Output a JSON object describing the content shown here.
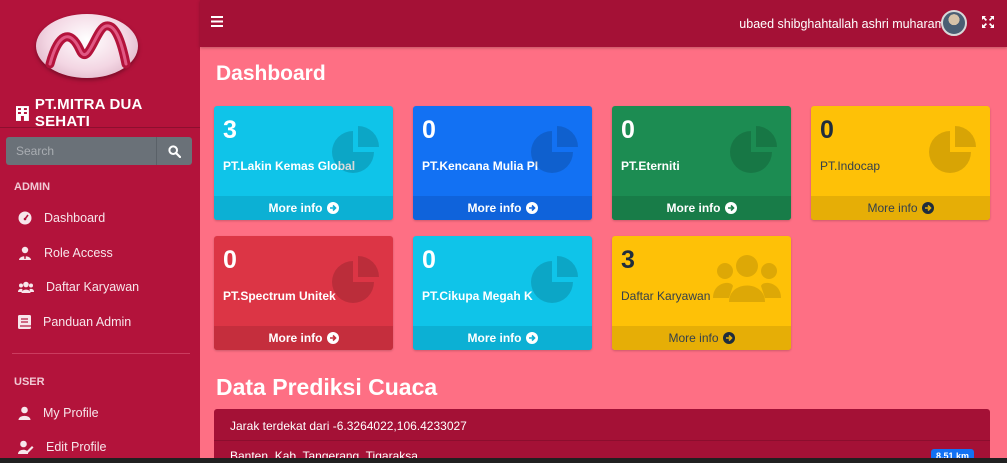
{
  "brand": {
    "name": "PT.MITRA DUA SEHATI"
  },
  "search": {
    "placeholder": "Search"
  },
  "sidebar": {
    "admin_header": "ADMIN",
    "user_header": "USER",
    "admin_items": [
      {
        "label": "Dashboard",
        "icon": "dashboard-icon"
      },
      {
        "label": "Role Access",
        "icon": "user-tie-icon"
      },
      {
        "label": "Daftar Karyawan",
        "icon": "users-icon"
      },
      {
        "label": "Panduan Admin",
        "icon": "book-icon"
      }
    ],
    "user_items": [
      {
        "label": "My Profile",
        "icon": "user-icon"
      },
      {
        "label": "Edit Profile",
        "icon": "user-edit-icon"
      }
    ]
  },
  "header": {
    "username": "ubaed shibghahtallah ashri muharam"
  },
  "main": {
    "title": "Dashboard",
    "boxes": [
      {
        "count": "3",
        "label": "PT.Lakin Kemas Global",
        "footer": "More info",
        "color": "#0fc4e9"
      },
      {
        "count": "0",
        "label": "PT.Kencana Mulia PI",
        "footer": "More info",
        "color": "#1271f3"
      },
      {
        "count": "0",
        "label": "PT.Eterniti",
        "footer": "More info",
        "color": "#1c8c52"
      },
      {
        "count": "0",
        "label": "PT.Indocap",
        "footer": "More info",
        "color": "#fec107"
      },
      {
        "count": "0",
        "label": "PT.Spectrum Unitek",
        "footer": "More info",
        "color": "#dc3545"
      },
      {
        "count": "0",
        "label": "PT.Cikupa Megah K",
        "footer": "More info",
        "color": "#0fc4e9"
      },
      {
        "count": "3",
        "label": "Daftar Karyawan",
        "footer": "More info",
        "color": "#fec107"
      }
    ],
    "weather_title": "Data Prediksi Cuaca",
    "weather_card": {
      "header": "Jarak terdekat dari -6.3264022,106.4233027",
      "row_label": "Banten, Kab. Tangerang, Tigaraksa",
      "row_badge": "8.51 km"
    }
  },
  "colors": {
    "sidebar": "#b3133b",
    "topbar": "#a41136",
    "content_bg": "#fe6f84"
  }
}
